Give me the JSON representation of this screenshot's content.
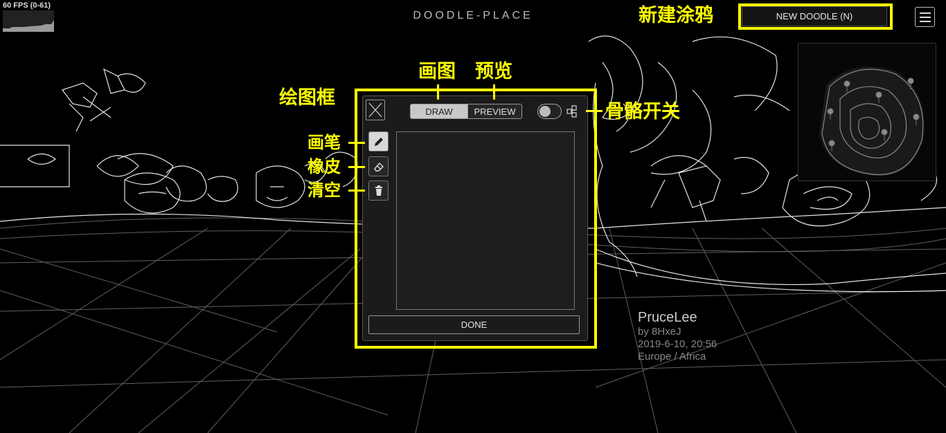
{
  "fps": {
    "label": "60 FPS (0-61)"
  },
  "header": {
    "title": "DOODLE-PLACE",
    "new_doodle_label": "NEW DOODLE (N)"
  },
  "annotations": {
    "new_doodle": "新建涂鸦",
    "draw_tab": "画图",
    "preview_tab": "预览",
    "draw_frame": "绘图框",
    "skeleton_toggle": "骨骼开关",
    "pen": "画笔",
    "eraser": "橡皮",
    "clear": "清空"
  },
  "editor": {
    "tabs": {
      "draw": "DRAW",
      "preview": "PREVIEW"
    },
    "active_tab": "draw",
    "skeleton_enabled": false,
    "tools": [
      {
        "name": "pen",
        "icon": "pencil-icon",
        "active": true
      },
      {
        "name": "eraser",
        "icon": "eraser-icon",
        "active": false
      },
      {
        "name": "clear",
        "icon": "trash-icon",
        "active": false
      }
    ],
    "done_label": "DONE"
  },
  "doodle_info": {
    "name": "PruceLee",
    "author": "by 8HxeJ",
    "date": "2019-6-10, 20:56",
    "region": "Europe / Africa"
  },
  "colors": {
    "highlight": "#ffff00",
    "background": "#000000",
    "line": "#ffffff"
  }
}
